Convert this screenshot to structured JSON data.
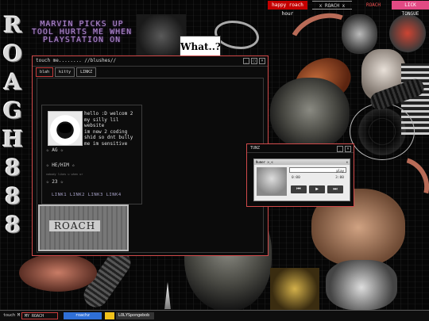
{
  "topbar": {
    "red_button": "happy roach hour",
    "x_button": "x ROACH x",
    "small_button": "ROACH",
    "pink_button": "LICK TONGUE"
  },
  "side_letters": [
    "R",
    "O",
    "A",
    "G",
    "H",
    "8",
    "8",
    "8"
  ],
  "headline": "MARVIN PICKS UP TOOL HURTS ME WHEN PLAYSTATION ON",
  "what_card": "What..?",
  "main_window": {
    "title": "touch me........ //blushes//",
    "tabs": [
      "blah",
      "kitty",
      "LINKZ"
    ],
    "bio": "hello :D welcom 2\nmy silly lil\nwebsite\nim new 2 coding\nshid so dnt bully\nme im sensitive",
    "stat_age": "☆ AG ☆",
    "stat_pronouns": "☆ HE/HIM ☆",
    "tiny_text": "nobody likes u when ur",
    "stat_age2": "☆ 23 ☆",
    "links": "LINK1 LINK2 LINK3 LINK4",
    "sticker_text": "ROACH"
  },
  "tunes_window": {
    "title": "TUNZ",
    "track": "Numer >_<",
    "select_value": "play",
    "time_start": "0:00",
    "time_end": "3:00",
    "ctrl_prev": "⏮",
    "ctrl_play": "▶",
    "ctrl_next": "⏭"
  },
  "taskbar": {
    "start": "touch M",
    "item1": "MY ROACH HUNTER",
    "item2": "roachz",
    "item3": "",
    "item4": "LOLYSpongebob"
  },
  "colors": {
    "accent_red": "#d14a4a",
    "pink": "#e24a84",
    "purple_text": "#b58fd1"
  }
}
